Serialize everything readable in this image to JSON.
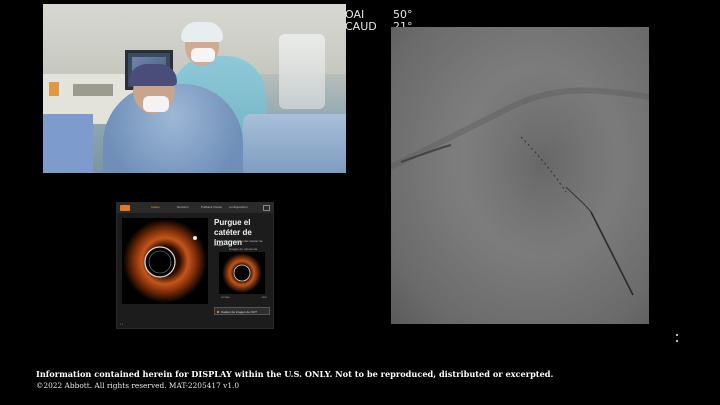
{
  "angio": {
    "view_1_label": "OAI",
    "view_1_value": "50°",
    "view_2_label": "CAUD",
    "view_2_value": "21°"
  },
  "oct_console": {
    "tabs": [
      "Casos",
      "Revisión",
      "Pullback Viewer",
      "Configuración"
    ],
    "active_tab_index": 0,
    "title": "Purgue el catéter de imagen",
    "instruction": "Compruebe la imagen del catéter de imagen",
    "reference_label": "Imagen de referencia",
    "reference_caption_left": "Limpio",
    "reference_caption_right": "Aire",
    "dropdown_value": "Catéter de imagen de OCT",
    "accent_color": "#e07a2a"
  },
  "footer": {
    "disclaimer": "Information contained herein for DISPLAY within the U.S. ONLY. Not to be reproduced, distributed or excerpted.",
    "copyright": "©2022 Abbott. All rights reserved. MAT-2205417 v1.0"
  }
}
